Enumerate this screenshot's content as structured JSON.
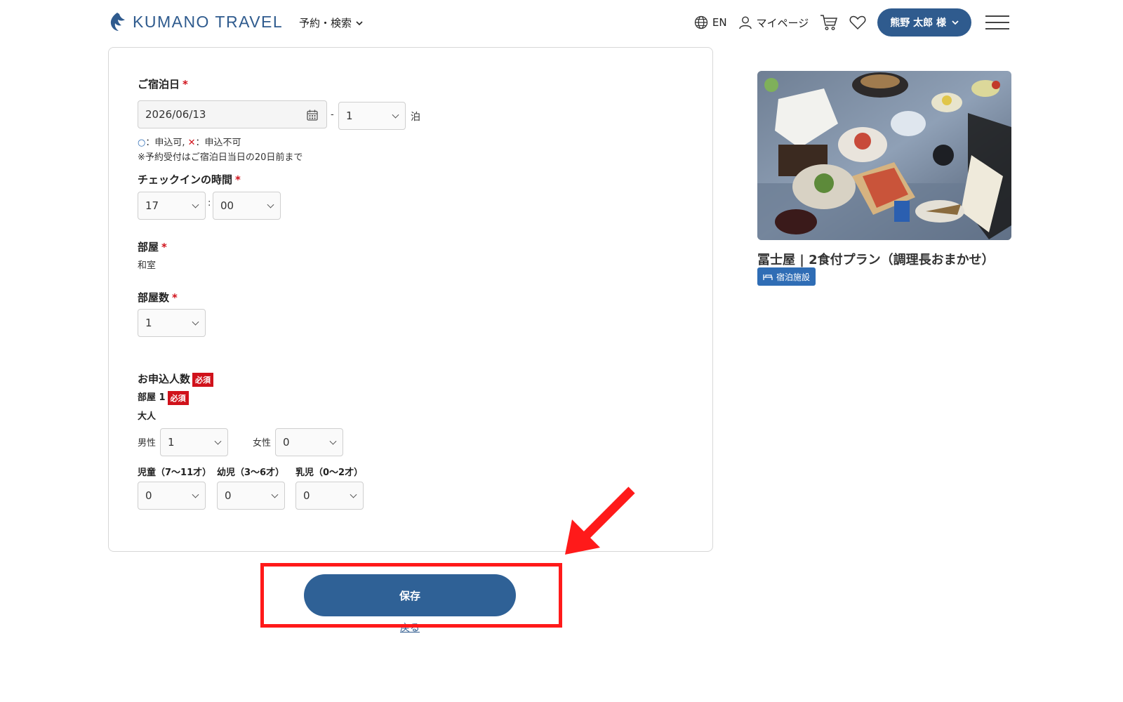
{
  "header": {
    "logo_text": "KUMANO TRAVEL",
    "nav_search": "予約・検索",
    "language": "EN",
    "mypage": "マイページ",
    "user_button": "熊野 太郎 様"
  },
  "form": {
    "stay_date_label": "ご宿泊日",
    "stay_date_value": "2026/06/13",
    "nights_separator": "-",
    "nights_value": "1",
    "nights_unit": "泊",
    "availability_legend_ok_mark": "○",
    "availability_legend_ok": "：申込可,",
    "availability_legend_ng_mark": "✕",
    "availability_legend_ng": "：申込不可",
    "reservation_note": "※予約受付はご宿泊日当日の20日前まで",
    "checkin_label": "チェックインの時間",
    "checkin_hour": "17",
    "checkin_colon": ":",
    "checkin_minute": "00",
    "room_label": "部屋",
    "room_value": "和室",
    "room_count_label": "部屋数",
    "room_count_value": "1",
    "applicants_label": "お申込人数",
    "required_badge": "必須",
    "room1_label": "部屋 1",
    "adult_label": "大人",
    "male_label": "男性",
    "male_value": "1",
    "female_label": "女性",
    "female_value": "0",
    "child_label": "児童（7〜11才）",
    "child_value": "0",
    "infant_label": "幼児（3〜6才）",
    "infant_value": "0",
    "baby_label": "乳児（0〜2才）",
    "baby_value": "0",
    "required_mark": "*"
  },
  "plan": {
    "title": "冨士屋 | 2食付プラン（調理長おまかせ）",
    "facility_tag": "宿泊施設"
  },
  "actions": {
    "save_label": "保存",
    "back_label": "戻る"
  },
  "colors": {
    "brand": "#2f5b8e",
    "required": "#d0121b",
    "annotation": "#ff1a1a"
  }
}
